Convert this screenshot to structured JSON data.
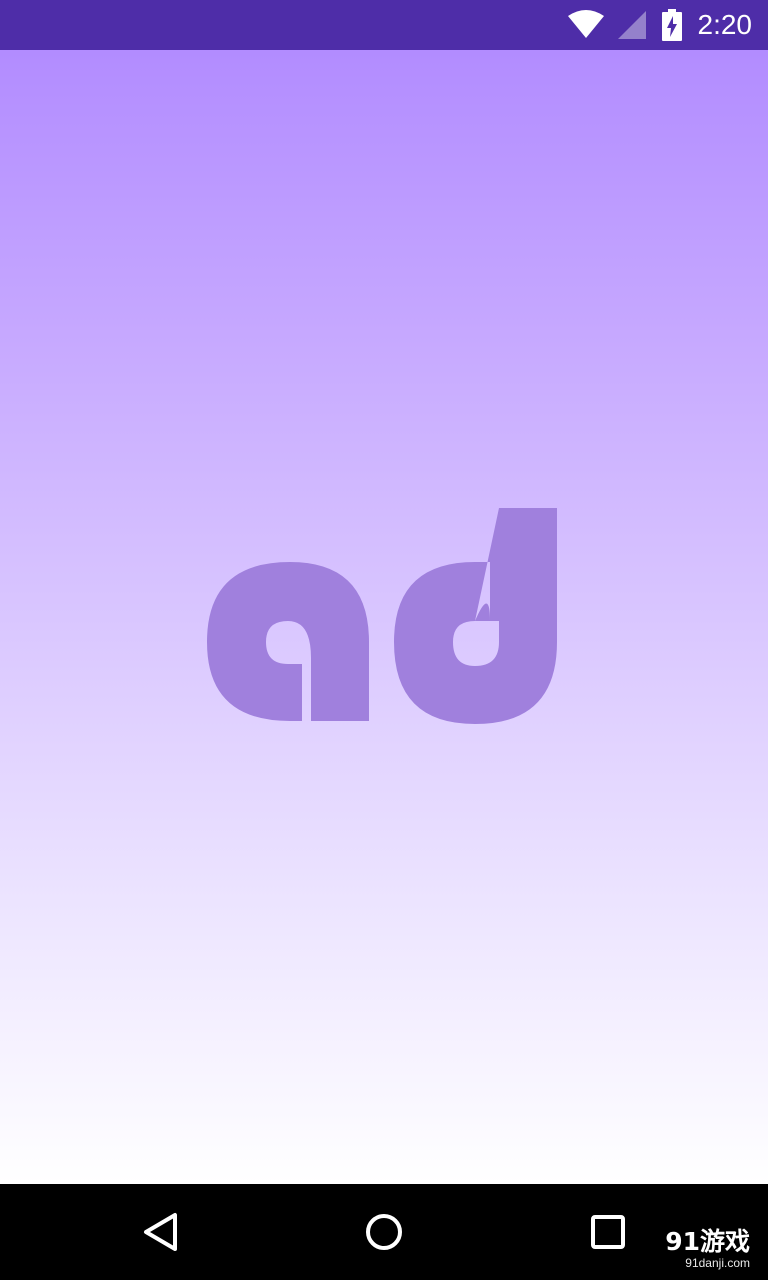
{
  "status_bar": {
    "time": "2:20",
    "icons": [
      "wifi-icon",
      "cellular-signal-icon",
      "battery-charging-icon"
    ],
    "background": "#4e2da8"
  },
  "splash": {
    "logo_text": "ad",
    "logo_color": "#a080dd",
    "gradient_top": "#b28cff",
    "gradient_bottom": "#ffffff"
  },
  "nav_bar": {
    "buttons": [
      "back-icon",
      "home-icon",
      "recents-icon"
    ]
  },
  "watermark": {
    "main": "91游戏",
    "sub": "91danji.com"
  }
}
